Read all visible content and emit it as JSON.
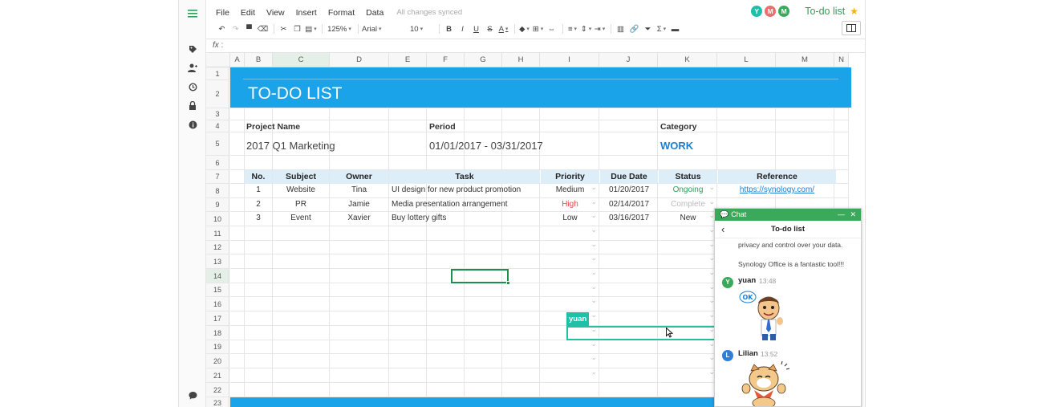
{
  "menu": [
    "File",
    "Edit",
    "View",
    "Insert",
    "Format",
    "Data"
  ],
  "sync_status": "All changes synced",
  "users": [
    {
      "initial": "Y",
      "color": "#1fbfa8"
    },
    {
      "initial": "M",
      "color": "#e9706f"
    },
    {
      "initial": "M",
      "color": "#3aaa5a"
    }
  ],
  "doc_title": "To-do list",
  "toolbar": {
    "zoom": "125%",
    "font": "Arial",
    "size": "10"
  },
  "formula_label": "fx",
  "columns": [
    "A",
    "B",
    "C",
    "D",
    "E",
    "F",
    "G",
    "H",
    "I",
    "J",
    "K",
    "L",
    "M",
    "N"
  ],
  "rows": [
    "1",
    "2",
    "3",
    "4",
    "5",
    "6",
    "7",
    "8",
    "9",
    "10",
    "11",
    "12",
    "13",
    "14",
    "15",
    "16",
    "17",
    "18",
    "19",
    "20",
    "21",
    "22",
    "23"
  ],
  "sheet": {
    "title": "TO-DO LIST",
    "project_label": "Project Name",
    "project_value": "2017 Q1 Marketing",
    "period_label": "Period",
    "period_value": "01/01/2017 - 03/31/2017",
    "category_label": "Category",
    "category_value": "WORK",
    "headers": {
      "no": "No.",
      "subject": "Subject",
      "owner": "Owner",
      "task": "Task",
      "priority": "Priority",
      "due": "Due Date",
      "status": "Status",
      "reference": "Reference"
    },
    "tasks": [
      {
        "no": "1",
        "subject": "Website",
        "owner": "Tina",
        "task": "UI design for new product promotion",
        "priority": "Medium",
        "due": "01/20/2017",
        "status": "Ongoing",
        "reference": "https://synology.com/"
      },
      {
        "no": "2",
        "subject": "PR",
        "owner": "Jamie",
        "task": "Media presentation arrangement",
        "priority": "High",
        "due": "02/14/2017",
        "status": "Complete",
        "reference": ""
      },
      {
        "no": "3",
        "subject": "Event",
        "owner": "Xavier",
        "task": "Buy lottery gifts",
        "priority": "Low",
        "due": "03/16/2017",
        "status": "New",
        "reference": ""
      }
    ],
    "collab_tag": "yuan"
  },
  "chat": {
    "header": "Chat",
    "title": "To-do list",
    "text1": "privacy and control over your data.",
    "text2": "Synology Office is a fantastic tool!!!",
    "messages": [
      {
        "initial": "Y",
        "name": "yuan",
        "time": "13:48",
        "color": "#3aaa5a",
        "sticker_text": "OK"
      },
      {
        "initial": "L",
        "name": "Lilian",
        "time": "13:52",
        "color": "#2f7ed8"
      }
    ]
  },
  "colors": {
    "banner": "#1aa3e8",
    "header_fill": "#ddeef9",
    "accent_green": "#2e9e57",
    "high": "#e34d4d",
    "complete": "#bbbbbb",
    "work": "#1a7fd4"
  }
}
